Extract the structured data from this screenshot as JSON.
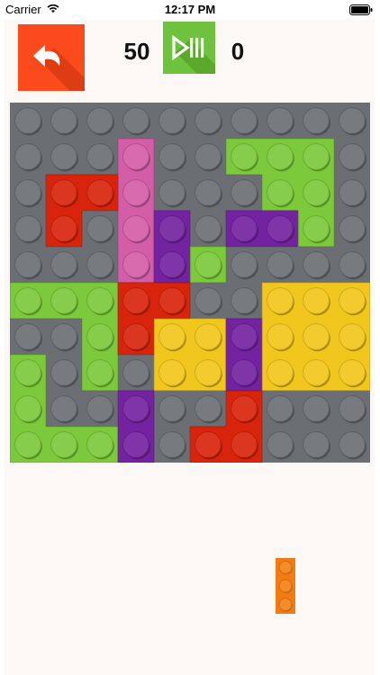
{
  "status_bar": {
    "carrier": "Carrier",
    "time": "12:17 PM"
  },
  "controls": {
    "undo_icon": "undo-arrow-icon",
    "play_icon": "play-pause-icon",
    "accent_colors": {
      "undo": "#fb4a1c",
      "play": "#6fc23d"
    }
  },
  "scores": {
    "left": "50",
    "right": "0"
  },
  "board": {
    "columns": 10,
    "rows": 10,
    "grid": [
      "gggggggggg",
      "gggPggLLLg",
      "gRRPgggLLg",
      "gRgPVgVVLg",
      "gggPVLgggg",
      "LLLRRggYYY",
      "ggLRYYVYYY",
      "LgLgYYVYYY",
      "LggVggRggg",
      "LLLVgRRggg"
    ],
    "palette": {
      "g": "#6b6e73",
      "L": "#7cc93c",
      "P": "#d35ea7",
      "R": "#d8240c",
      "V": "#7423a0",
      "Y": "#f2c71d"
    }
  },
  "next_piece": {
    "color": "#f07c14",
    "cells": 3,
    "orientation": "vertical"
  }
}
